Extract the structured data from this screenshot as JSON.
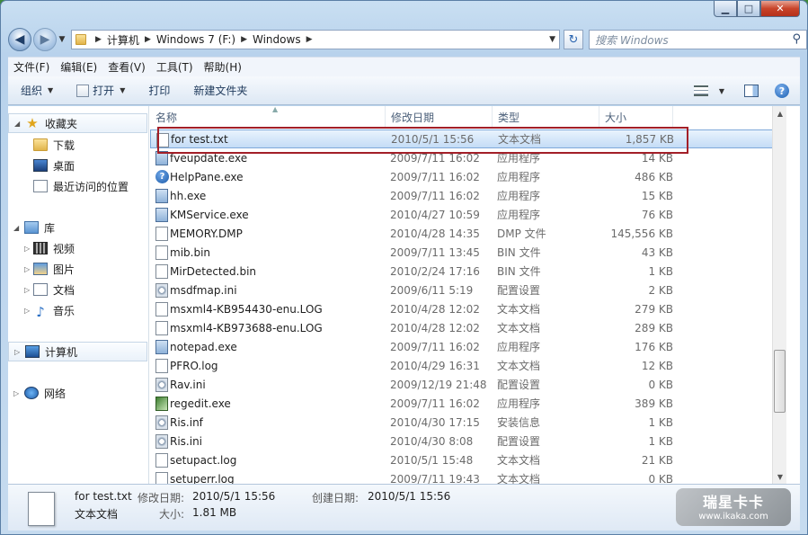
{
  "window": {
    "min_label": "▁",
    "max_label": "□",
    "close_label": "✕"
  },
  "nav": {
    "back_label": "◀",
    "forward_label": "▶",
    "breadcrumbs": [
      "计算机",
      "Windows 7 (F:)",
      "Windows"
    ],
    "search_placeholder": "搜索 Windows"
  },
  "menu": [
    "文件(F)",
    "编辑(E)",
    "查看(V)",
    "工具(T)",
    "帮助(H)"
  ],
  "toolbar": {
    "organize": "组织",
    "open": "打开",
    "print": "打印",
    "new_folder": "新建文件夹"
  },
  "sidebar": {
    "favorites": "收藏夹",
    "favorites_items": [
      "下载",
      "桌面",
      "最近访问的位置"
    ],
    "libraries": "库",
    "library_items": [
      "视频",
      "图片",
      "文档",
      "音乐"
    ],
    "computer": "计算机",
    "network": "网络"
  },
  "columns": {
    "name": "名称",
    "date": "修改日期",
    "type": "类型",
    "size": "大小"
  },
  "files": [
    {
      "name": "for test.txt",
      "date": "2010/5/1 15:56",
      "type": "文本文档",
      "size": "1,857 KB",
      "icon": "text-file-icon",
      "selected": true
    },
    {
      "name": "fveupdate.exe",
      "date": "2009/7/11 16:02",
      "type": "应用程序",
      "size": "14 KB",
      "icon": "exe-file-icon"
    },
    {
      "name": "HelpPane.exe",
      "date": "2009/7/11 16:02",
      "type": "应用程序",
      "size": "486 KB",
      "icon": "help-file-icon"
    },
    {
      "name": "hh.exe",
      "date": "2009/7/11 16:02",
      "type": "应用程序",
      "size": "15 KB",
      "icon": "exe-file-icon"
    },
    {
      "name": "KMService.exe",
      "date": "2010/4/27 10:59",
      "type": "应用程序",
      "size": "76 KB",
      "icon": "exe-file-icon"
    },
    {
      "name": "MEMORY.DMP",
      "date": "2010/4/28 14:35",
      "type": "DMP 文件",
      "size": "145,556 KB",
      "icon": "blank-file-icon"
    },
    {
      "name": "mib.bin",
      "date": "2009/7/11 13:45",
      "type": "BIN 文件",
      "size": "43 KB",
      "icon": "blank-file-icon"
    },
    {
      "name": "MirDetected.bin",
      "date": "2010/2/24 17:16",
      "type": "BIN 文件",
      "size": "1 KB",
      "icon": "blank-file-icon"
    },
    {
      "name": "msdfmap.ini",
      "date": "2009/6/11 5:19",
      "type": "配置设置",
      "size": "2 KB",
      "icon": "ini-file-icon"
    },
    {
      "name": "msxml4-KB954430-enu.LOG",
      "date": "2010/4/28 12:02",
      "type": "文本文档",
      "size": "279 KB",
      "icon": "text-file-icon"
    },
    {
      "name": "msxml4-KB973688-enu.LOG",
      "date": "2010/4/28 12:02",
      "type": "文本文档",
      "size": "289 KB",
      "icon": "text-file-icon"
    },
    {
      "name": "notepad.exe",
      "date": "2009/7/11 16:02",
      "type": "应用程序",
      "size": "176 KB",
      "icon": "notepad-icon"
    },
    {
      "name": "PFRO.log",
      "date": "2010/4/29 16:31",
      "type": "文本文档",
      "size": "12 KB",
      "icon": "text-file-icon"
    },
    {
      "name": "Rav.ini",
      "date": "2009/12/19 21:48",
      "type": "配置设置",
      "size": "0 KB",
      "icon": "ini-file-icon"
    },
    {
      "name": "regedit.exe",
      "date": "2009/7/11 16:02",
      "type": "应用程序",
      "size": "389 KB",
      "icon": "regedit-icon"
    },
    {
      "name": "Ris.inf",
      "date": "2010/4/30 17:15",
      "type": "安装信息",
      "size": "1 KB",
      "icon": "ini-file-icon"
    },
    {
      "name": "Ris.ini",
      "date": "2010/4/30 8:08",
      "type": "配置设置",
      "size": "1 KB",
      "icon": "ini-file-icon"
    },
    {
      "name": "setupact.log",
      "date": "2010/5/1 15:48",
      "type": "文本文档",
      "size": "21 KB",
      "icon": "text-file-icon"
    },
    {
      "name": "setuperr.log",
      "date": "2009/7/11 19:43",
      "type": "文本文档",
      "size": "0 KB",
      "icon": "text-file-icon"
    }
  ],
  "details": {
    "filename": "for test.txt",
    "filetype": "文本文档",
    "modified_label": "修改日期:",
    "modified_value": "2010/5/1 15:56",
    "created_label": "创建日期:",
    "created_value": "2010/5/1 15:56",
    "size_label": "大小:",
    "size_value": "1.81 MB"
  },
  "watermark": {
    "title": "瑞星卡卡",
    "url": "www.ikaka.com"
  },
  "colors": {
    "highlight": "#a31f28",
    "selection": "#c4dcf6",
    "desktop": "#3e8a3b"
  }
}
